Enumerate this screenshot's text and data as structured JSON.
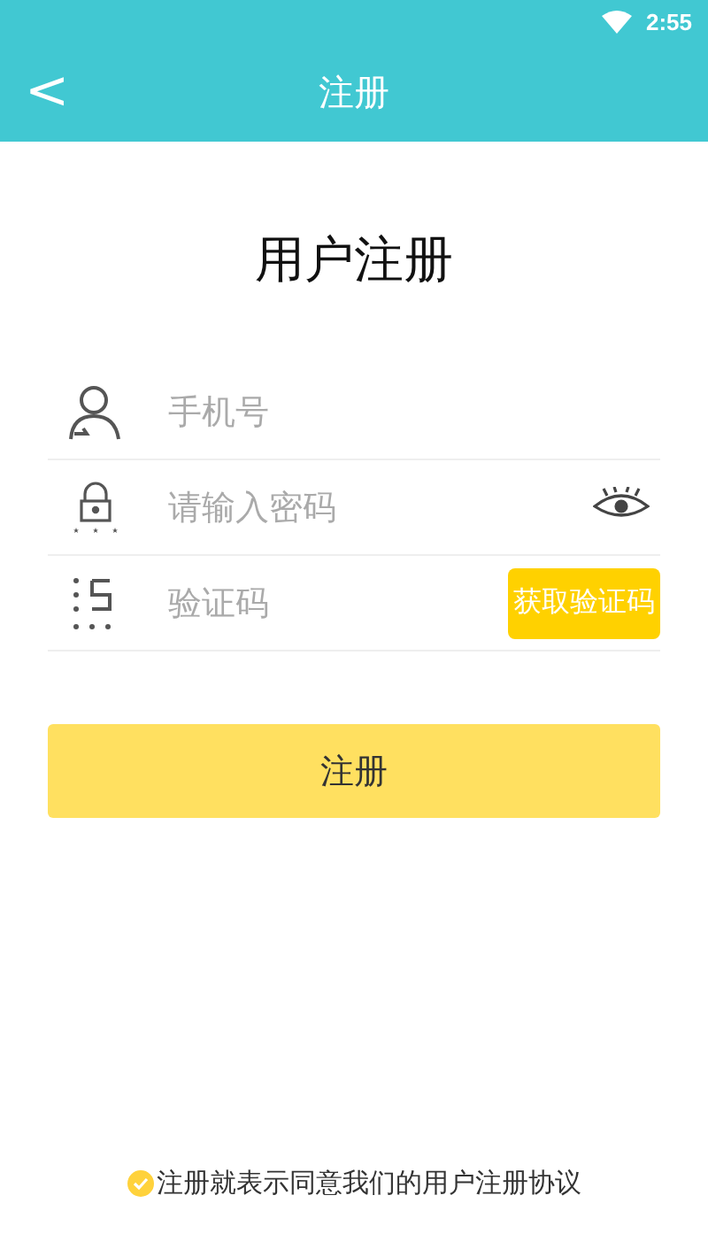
{
  "status_bar": {
    "time": "2:55"
  },
  "header": {
    "back": "<",
    "title": "注册"
  },
  "heading": "用户注册",
  "fields": [
    {
      "kind": "phone",
      "placeholder": "手机号"
    },
    {
      "kind": "password",
      "placeholder": "请输入密码"
    },
    {
      "kind": "code",
      "placeholder": "验证码",
      "action": "获取验证码"
    }
  ],
  "submit": "注册",
  "agreement": {
    "checked": true,
    "text": "注册就表示同意我们的用户注册协议"
  }
}
